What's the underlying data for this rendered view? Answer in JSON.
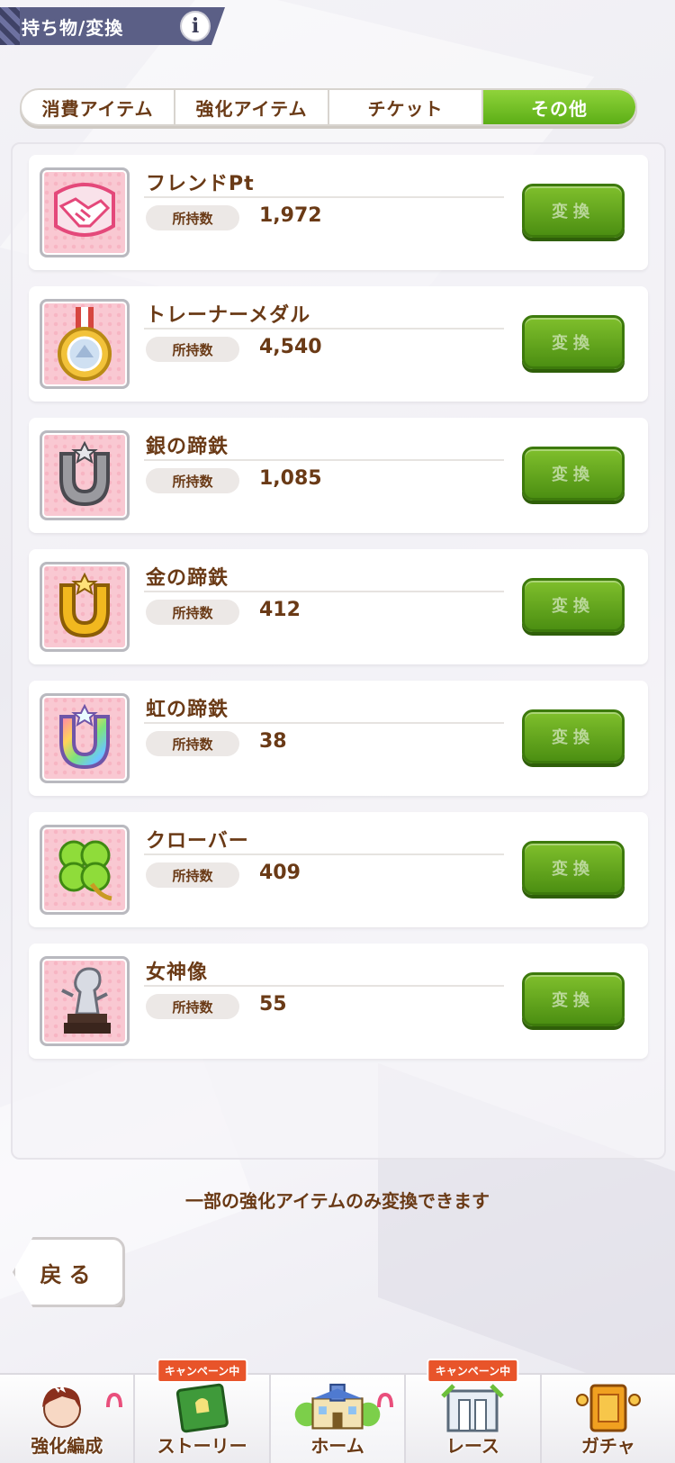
{
  "header": {
    "title": "持ち物/変換",
    "info_label": "i"
  },
  "tabs": [
    {
      "label": "消費アイテム",
      "active": false
    },
    {
      "label": "強化アイテム",
      "active": false
    },
    {
      "label": "チケット",
      "active": false
    },
    {
      "label": "その他",
      "active": true
    }
  ],
  "items": [
    {
      "name": "フレンドPt",
      "qty_label": "所持数",
      "qty": "1,972",
      "button": "変換",
      "icon": "handshake-icon"
    },
    {
      "name": "トレーナーメダル",
      "qty_label": "所持数",
      "qty": "4,540",
      "button": "変換",
      "icon": "medal-icon"
    },
    {
      "name": "銀の蹄鉄",
      "qty_label": "所持数",
      "qty": "1,085",
      "button": "変換",
      "icon": "silver-horseshoe-icon"
    },
    {
      "name": "金の蹄鉄",
      "qty_label": "所持数",
      "qty": "412",
      "button": "変換",
      "icon": "gold-horseshoe-icon"
    },
    {
      "name": "虹の蹄鉄",
      "qty_label": "所持数",
      "qty": "38",
      "button": "変換",
      "icon": "rainbow-horseshoe-icon"
    },
    {
      "name": "クローバー",
      "qty_label": "所持数",
      "qty": "409",
      "button": "変換",
      "icon": "clover-icon"
    },
    {
      "name": "女神像",
      "qty_label": "所持数",
      "qty": "55",
      "button": "変換",
      "icon": "goddess-statue-icon"
    }
  ],
  "note": "一部の強化アイテムのみ変換できます",
  "back_button": "戻る",
  "nav": [
    {
      "label": "強化編成",
      "badge": ""
    },
    {
      "label": "ストーリー",
      "badge": "キャンペーン中"
    },
    {
      "label": "ホーム",
      "badge": ""
    },
    {
      "label": "レース",
      "badge": "キャンペーン中"
    },
    {
      "label": "ガチャ",
      "badge": ""
    }
  ],
  "colors": {
    "accent_green": "#5cae16",
    "text_brown": "#6a3a16",
    "header_bg": "#5b5f86",
    "badge_orange": "#e8542a"
  }
}
